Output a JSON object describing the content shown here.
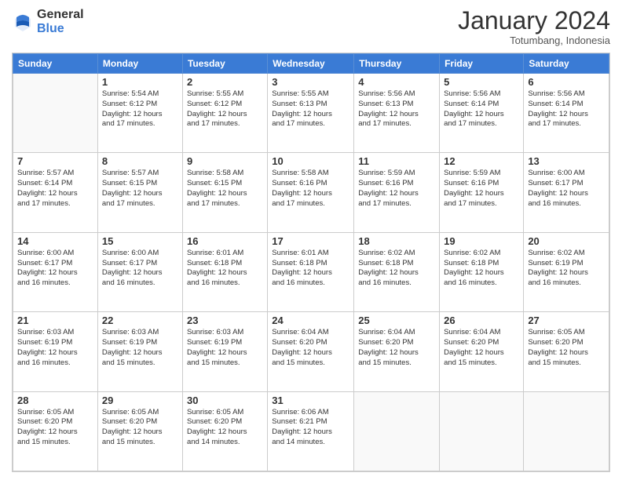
{
  "header": {
    "logo_general": "General",
    "logo_blue": "Blue",
    "month_title": "January 2024",
    "subtitle": "Totumbang, Indonesia"
  },
  "days": [
    "Sunday",
    "Monday",
    "Tuesday",
    "Wednesday",
    "Thursday",
    "Friday",
    "Saturday"
  ],
  "weeks": [
    [
      {
        "day": "",
        "info": ""
      },
      {
        "day": "1",
        "info": "Sunrise: 5:54 AM\nSunset: 6:12 PM\nDaylight: 12 hours\nand 17 minutes."
      },
      {
        "day": "2",
        "info": "Sunrise: 5:55 AM\nSunset: 6:12 PM\nDaylight: 12 hours\nand 17 minutes."
      },
      {
        "day": "3",
        "info": "Sunrise: 5:55 AM\nSunset: 6:13 PM\nDaylight: 12 hours\nand 17 minutes."
      },
      {
        "day": "4",
        "info": "Sunrise: 5:56 AM\nSunset: 6:13 PM\nDaylight: 12 hours\nand 17 minutes."
      },
      {
        "day": "5",
        "info": "Sunrise: 5:56 AM\nSunset: 6:14 PM\nDaylight: 12 hours\nand 17 minutes."
      },
      {
        "day": "6",
        "info": "Sunrise: 5:56 AM\nSunset: 6:14 PM\nDaylight: 12 hours\nand 17 minutes."
      }
    ],
    [
      {
        "day": "7",
        "info": "Sunrise: 5:57 AM\nSunset: 6:14 PM\nDaylight: 12 hours\nand 17 minutes."
      },
      {
        "day": "8",
        "info": "Sunrise: 5:57 AM\nSunset: 6:15 PM\nDaylight: 12 hours\nand 17 minutes."
      },
      {
        "day": "9",
        "info": "Sunrise: 5:58 AM\nSunset: 6:15 PM\nDaylight: 12 hours\nand 17 minutes."
      },
      {
        "day": "10",
        "info": "Sunrise: 5:58 AM\nSunset: 6:16 PM\nDaylight: 12 hours\nand 17 minutes."
      },
      {
        "day": "11",
        "info": "Sunrise: 5:59 AM\nSunset: 6:16 PM\nDaylight: 12 hours\nand 17 minutes."
      },
      {
        "day": "12",
        "info": "Sunrise: 5:59 AM\nSunset: 6:16 PM\nDaylight: 12 hours\nand 17 minutes."
      },
      {
        "day": "13",
        "info": "Sunrise: 6:00 AM\nSunset: 6:17 PM\nDaylight: 12 hours\nand 16 minutes."
      }
    ],
    [
      {
        "day": "14",
        "info": "Sunrise: 6:00 AM\nSunset: 6:17 PM\nDaylight: 12 hours\nand 16 minutes."
      },
      {
        "day": "15",
        "info": "Sunrise: 6:00 AM\nSunset: 6:17 PM\nDaylight: 12 hours\nand 16 minutes."
      },
      {
        "day": "16",
        "info": "Sunrise: 6:01 AM\nSunset: 6:18 PM\nDaylight: 12 hours\nand 16 minutes."
      },
      {
        "day": "17",
        "info": "Sunrise: 6:01 AM\nSunset: 6:18 PM\nDaylight: 12 hours\nand 16 minutes."
      },
      {
        "day": "18",
        "info": "Sunrise: 6:02 AM\nSunset: 6:18 PM\nDaylight: 12 hours\nand 16 minutes."
      },
      {
        "day": "19",
        "info": "Sunrise: 6:02 AM\nSunset: 6:18 PM\nDaylight: 12 hours\nand 16 minutes."
      },
      {
        "day": "20",
        "info": "Sunrise: 6:02 AM\nSunset: 6:19 PM\nDaylight: 12 hours\nand 16 minutes."
      }
    ],
    [
      {
        "day": "21",
        "info": "Sunrise: 6:03 AM\nSunset: 6:19 PM\nDaylight: 12 hours\nand 16 minutes."
      },
      {
        "day": "22",
        "info": "Sunrise: 6:03 AM\nSunset: 6:19 PM\nDaylight: 12 hours\nand 15 minutes."
      },
      {
        "day": "23",
        "info": "Sunrise: 6:03 AM\nSunset: 6:19 PM\nDaylight: 12 hours\nand 15 minutes."
      },
      {
        "day": "24",
        "info": "Sunrise: 6:04 AM\nSunset: 6:20 PM\nDaylight: 12 hours\nand 15 minutes."
      },
      {
        "day": "25",
        "info": "Sunrise: 6:04 AM\nSunset: 6:20 PM\nDaylight: 12 hours\nand 15 minutes."
      },
      {
        "day": "26",
        "info": "Sunrise: 6:04 AM\nSunset: 6:20 PM\nDaylight: 12 hours\nand 15 minutes."
      },
      {
        "day": "27",
        "info": "Sunrise: 6:05 AM\nSunset: 6:20 PM\nDaylight: 12 hours\nand 15 minutes."
      }
    ],
    [
      {
        "day": "28",
        "info": "Sunrise: 6:05 AM\nSunset: 6:20 PM\nDaylight: 12 hours\nand 15 minutes."
      },
      {
        "day": "29",
        "info": "Sunrise: 6:05 AM\nSunset: 6:20 PM\nDaylight: 12 hours\nand 15 minutes."
      },
      {
        "day": "30",
        "info": "Sunrise: 6:05 AM\nSunset: 6:20 PM\nDaylight: 12 hours\nand 14 minutes."
      },
      {
        "day": "31",
        "info": "Sunrise: 6:06 AM\nSunset: 6:21 PM\nDaylight: 12 hours\nand 14 minutes."
      },
      {
        "day": "",
        "info": ""
      },
      {
        "day": "",
        "info": ""
      },
      {
        "day": "",
        "info": ""
      }
    ]
  ]
}
